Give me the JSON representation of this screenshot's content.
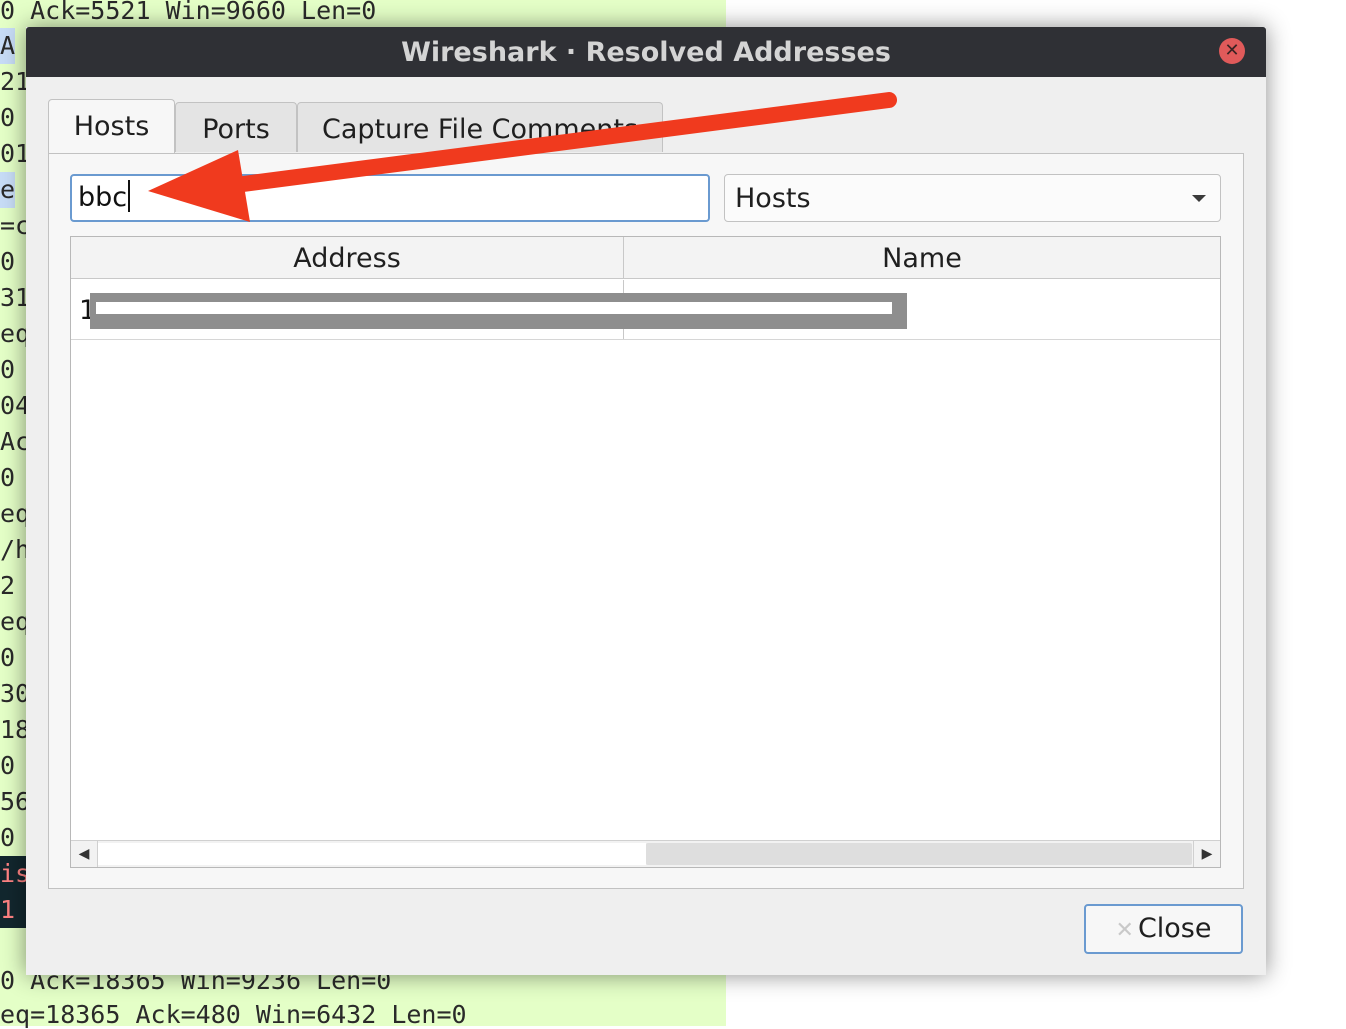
{
  "background_packets": {
    "top_line": "0 Ack=5521 Win=9660 Len=0",
    "row_fragments": [
      "A",
      "21",
      "0",
      "01",
      "e",
      "=c",
      "0",
      "31",
      "eq",
      "0",
      "04",
      "Ac",
      "0",
      "eq",
      "/h",
      "2",
      "eq",
      "0",
      "30",
      "18",
      "0",
      "56",
      "0",
      "is",
      "1"
    ],
    "bottom_line_1": "0 Ack=18365 Win=9236 Len=0",
    "bottom_line_2": "eq=18365 Ack=480 Win=6432 Len=0"
  },
  "dialog": {
    "title": "Wireshark · Resolved Addresses",
    "close_icon": "close-icon"
  },
  "tabs": [
    {
      "label": "Hosts",
      "active": true
    },
    {
      "label": "Ports",
      "active": false
    },
    {
      "label": "Capture File Comments",
      "active": false
    }
  ],
  "filter": {
    "value": "bbc"
  },
  "select": {
    "selected": "Hosts"
  },
  "table": {
    "columns": [
      "Address",
      "Name"
    ],
    "rows": [
      {
        "address": "1",
        "name": ""
      }
    ]
  },
  "buttons": {
    "close_label": "Close"
  },
  "colors": {
    "accent": "#6a9ad0",
    "annotation_arrow": "#f03a1e",
    "packet_bg": "#e4ffc7"
  }
}
